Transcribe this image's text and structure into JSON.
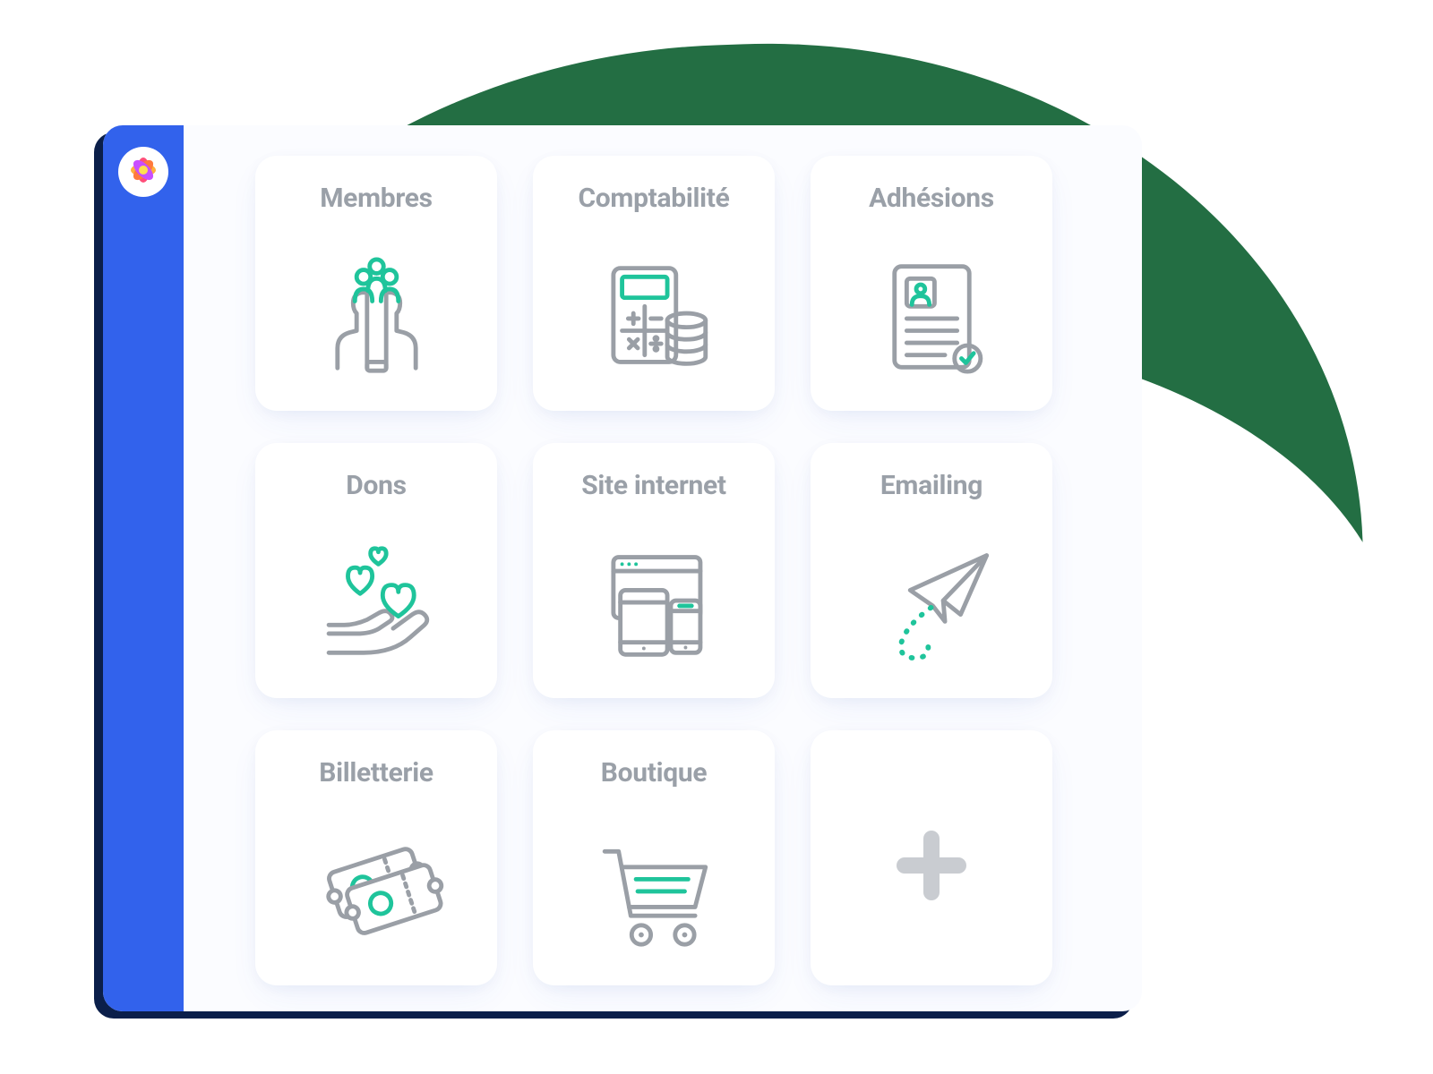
{
  "colors": {
    "bg_blob": "#236e43",
    "sidebar": "#3262ec",
    "card_title": "#9aa0a8",
    "icon_line": "#9a9fa6",
    "icon_accent": "#1fc49b",
    "add_plus": "#c9ccd1"
  },
  "cards": [
    {
      "label": "Membres",
      "icon": "members-icon"
    },
    {
      "label": "Comptabilité",
      "icon": "accounting-icon"
    },
    {
      "label": "Adhésions",
      "icon": "subscriptions-icon"
    },
    {
      "label": "Dons",
      "icon": "donations-icon"
    },
    {
      "label": "Site internet",
      "icon": "website-icon"
    },
    {
      "label": "Emailing",
      "icon": "emailing-icon"
    },
    {
      "label": "Billetterie",
      "icon": "ticketing-icon"
    },
    {
      "label": "Boutique",
      "icon": "shop-icon"
    }
  ],
  "add_card": {
    "icon": "plus-icon"
  }
}
